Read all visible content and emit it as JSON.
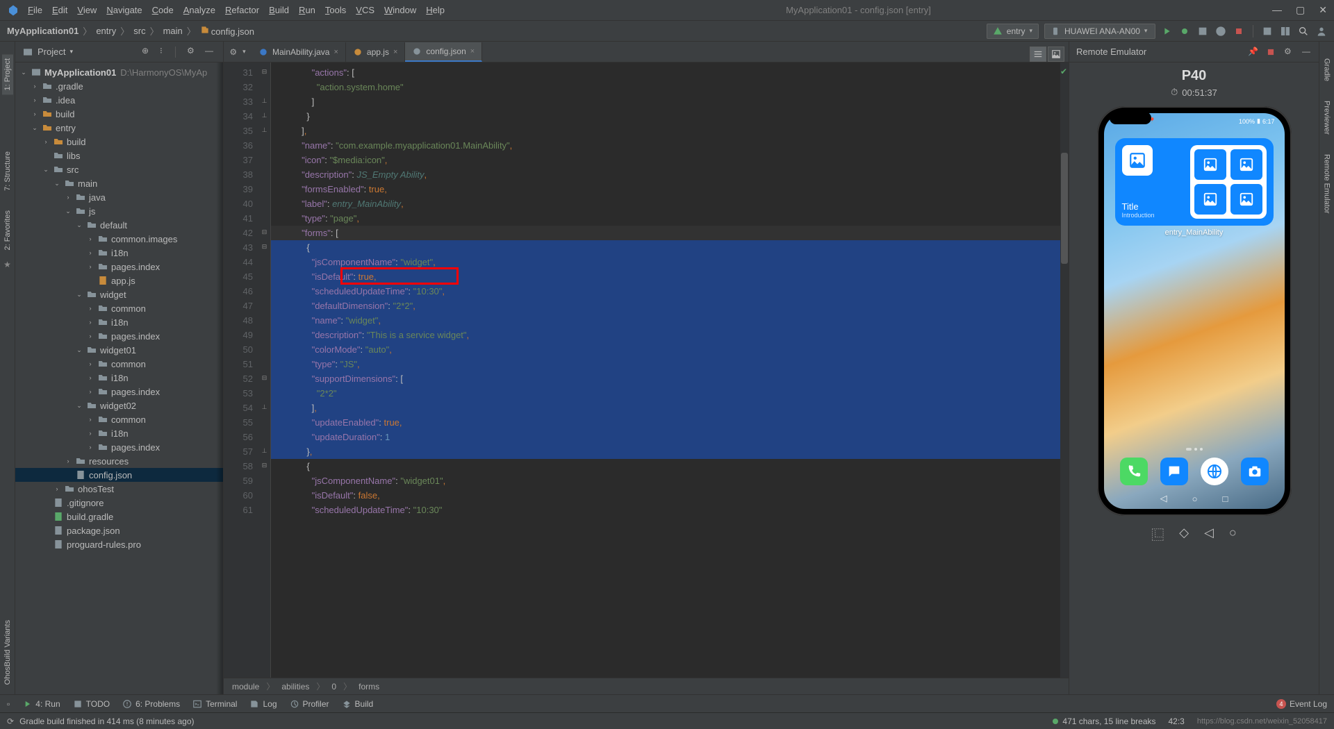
{
  "menubar": {
    "items": [
      "File",
      "Edit",
      "View",
      "Navigate",
      "Code",
      "Analyze",
      "Refactor",
      "Build",
      "Run",
      "Tools",
      "VCS",
      "Window",
      "Help"
    ],
    "title": "MyApplication01 - config.json [entry]"
  },
  "breadcrumbs": [
    "MyApplication01",
    "entry",
    "src",
    "main",
    "config.json"
  ],
  "run_config": {
    "module": "entry",
    "device": "HUAWEI ANA-AN00",
    "device_chev": "▾"
  },
  "editor_tabs": [
    {
      "name": "MainAbility.java",
      "icon": "java"
    },
    {
      "name": "app.js",
      "icon": "js"
    },
    {
      "name": "config.json",
      "icon": "json",
      "active": true
    }
  ],
  "project_panel": {
    "title": "Project"
  },
  "project_tree": {
    "root": {
      "name": "MyApplication01",
      "path": "D:\\HarmonyOS\\MyAp"
    },
    "rows": [
      {
        "indent": 1,
        "arrow": "›",
        "icon": "folder",
        "label": ".gradle"
      },
      {
        "indent": 1,
        "arrow": "›",
        "icon": "folder",
        "label": ".idea"
      },
      {
        "indent": 1,
        "arrow": "›",
        "icon": "folder-o",
        "label": "build"
      },
      {
        "indent": 1,
        "arrow": "⌄",
        "icon": "folder-o",
        "label": "entry"
      },
      {
        "indent": 2,
        "arrow": "›",
        "icon": "folder-o",
        "label": "build"
      },
      {
        "indent": 2,
        "arrow": "",
        "icon": "folder",
        "label": "libs"
      },
      {
        "indent": 2,
        "arrow": "⌄",
        "icon": "folder",
        "label": "src"
      },
      {
        "indent": 3,
        "arrow": "⌄",
        "icon": "folder",
        "label": "main"
      },
      {
        "indent": 4,
        "arrow": "›",
        "icon": "folder",
        "label": "java"
      },
      {
        "indent": 4,
        "arrow": "⌄",
        "icon": "folder",
        "label": "js"
      },
      {
        "indent": 5,
        "arrow": "⌄",
        "icon": "folder",
        "label": "default"
      },
      {
        "indent": 6,
        "arrow": "›",
        "icon": "folder",
        "label": "common.images"
      },
      {
        "indent": 6,
        "arrow": "›",
        "icon": "folder",
        "label": "i18n"
      },
      {
        "indent": 6,
        "arrow": "›",
        "icon": "folder",
        "label": "pages.index"
      },
      {
        "indent": 6,
        "arrow": "",
        "icon": "file-js",
        "label": "app.js"
      },
      {
        "indent": 5,
        "arrow": "⌄",
        "icon": "folder",
        "label": "widget"
      },
      {
        "indent": 6,
        "arrow": "›",
        "icon": "folder",
        "label": "common"
      },
      {
        "indent": 6,
        "arrow": "›",
        "icon": "folder",
        "label": "i18n"
      },
      {
        "indent": 6,
        "arrow": "›",
        "icon": "folder",
        "label": "pages.index"
      },
      {
        "indent": 5,
        "arrow": "⌄",
        "icon": "folder",
        "label": "widget01"
      },
      {
        "indent": 6,
        "arrow": "›",
        "icon": "folder",
        "label": "common"
      },
      {
        "indent": 6,
        "arrow": "›",
        "icon": "folder",
        "label": "i18n"
      },
      {
        "indent": 6,
        "arrow": "›",
        "icon": "folder",
        "label": "pages.index"
      },
      {
        "indent": 5,
        "arrow": "⌄",
        "icon": "folder",
        "label": "widget02"
      },
      {
        "indent": 6,
        "arrow": "›",
        "icon": "folder",
        "label": "common"
      },
      {
        "indent": 6,
        "arrow": "›",
        "icon": "folder",
        "label": "i18n"
      },
      {
        "indent": 6,
        "arrow": "›",
        "icon": "folder",
        "label": "pages.index"
      },
      {
        "indent": 4,
        "arrow": "›",
        "icon": "folder",
        "label": "resources"
      },
      {
        "indent": 4,
        "arrow": "",
        "icon": "file-json",
        "label": "config.json",
        "selected": true
      },
      {
        "indent": 3,
        "arrow": "›",
        "icon": "folder",
        "label": "ohosTest"
      },
      {
        "indent": 2,
        "arrow": "",
        "icon": "file",
        "label": ".gitignore"
      },
      {
        "indent": 2,
        "arrow": "",
        "icon": "file-gradle",
        "label": "build.gradle"
      },
      {
        "indent": 2,
        "arrow": "",
        "icon": "file-json",
        "label": "package.json"
      },
      {
        "indent": 2,
        "arrow": "",
        "icon": "file",
        "label": "proguard-rules.pro"
      }
    ]
  },
  "code": {
    "first_line": 31,
    "lines": [
      {
        "n": 31,
        "html": "              <span class='tok-key'>\"actions\"</span>: <span class='tok-brace'>[</span>"
      },
      {
        "n": 32,
        "html": "                <span class='tok-str'>\"action.system.home\"</span>"
      },
      {
        "n": 33,
        "html": "              <span class='tok-brace'>]</span>"
      },
      {
        "n": 34,
        "html": "            <span class='tok-brace'>}</span>"
      },
      {
        "n": 35,
        "html": "          <span class='tok-brace'>]</span><span class='tok-punc'>,</span>"
      },
      {
        "n": 36,
        "html": "          <span class='tok-key'>\"name\"</span>: <span class='tok-str'>\"com.example.myapplication01.MainAbility\"</span><span class='tok-punc'>,</span>"
      },
      {
        "n": 37,
        "html": "          <span class='tok-key'>\"icon\"</span>: <span class='tok-str'>\"$media:icon\"</span><span class='tok-punc'>,</span>"
      },
      {
        "n": 38,
        "html": "          <span class='tok-key'>\"description\"</span>: <span class='tok-ref'>JS_Empty Ability</span><span class='tok-punc'>,</span>"
      },
      {
        "n": 39,
        "html": "          <span class='tok-key'>\"formsEnabled\"</span>: <span class='tok-bool'>true</span><span class='tok-punc'>,</span>"
      },
      {
        "n": 40,
        "html": "          <span class='tok-key'>\"label\"</span>: <span class='tok-ref'>entry_MainAbility</span><span class='tok-punc'>,</span>"
      },
      {
        "n": 41,
        "html": "          <span class='tok-key'>\"type\"</span>: <span class='tok-str'>\"page\"</span><span class='tok-punc'>,</span>"
      },
      {
        "n": 42,
        "sel": true,
        "cursor": true,
        "html": "          <span class='tok-key'>\"forms\"</span>: <span class='tok-brace'>[</span>"
      },
      {
        "n": 43,
        "sel": true,
        "html": "            <span class='tok-brace'>{</span>"
      },
      {
        "n": 44,
        "sel": true,
        "html": "              <span class='tok-key'>\"jsComponentName\"</span>: <span class='tok-str'>\"widget\"</span><span class='tok-punc'>,</span>"
      },
      {
        "n": 45,
        "sel": true,
        "html": "              <span class='tok-key'>\"isDefault\"</span>: <span class='tok-bool'>true</span><span class='tok-punc'>,</span>"
      },
      {
        "n": 46,
        "sel": true,
        "html": "              <span class='tok-key'>\"scheduledUpdateTime\"</span>: <span class='tok-str'>\"10:30\"</span><span class='tok-punc'>,</span>"
      },
      {
        "n": 47,
        "sel": true,
        "html": "              <span class='tok-key'>\"defaultDimension\"</span>: <span class='tok-str'>\"2*2\"</span><span class='tok-punc'>,</span>"
      },
      {
        "n": 48,
        "sel": true,
        "html": "              <span class='tok-key'>\"name\"</span>: <span class='tok-str'>\"widget\"</span><span class='tok-punc'>,</span>"
      },
      {
        "n": 49,
        "sel": true,
        "html": "              <span class='tok-key'>\"description\"</span>: <span class='tok-str'>\"This is a service widget\"</span><span class='tok-punc'>,</span>"
      },
      {
        "n": 50,
        "sel": true,
        "html": "              <span class='tok-key'>\"colorMode\"</span>: <span class='tok-str'>\"auto\"</span><span class='tok-punc'>,</span>"
      },
      {
        "n": 51,
        "sel": true,
        "html": "              <span class='tok-key'>\"type\"</span>: <span class='tok-str'>\"JS\"</span><span class='tok-punc'>,</span>"
      },
      {
        "n": 52,
        "sel": true,
        "html": "              <span class='tok-key'>\"supportDimensions\"</span>: <span class='tok-brace'>[</span>"
      },
      {
        "n": 53,
        "sel": true,
        "html": "                <span class='tok-str'>\"2*2\"</span>"
      },
      {
        "n": 54,
        "sel": true,
        "html": "              <span class='tok-brace'>]</span><span class='tok-punc'>,</span>"
      },
      {
        "n": 55,
        "sel": true,
        "html": "              <span class='tok-key'>\"updateEnabled\"</span>: <span class='tok-bool'>true</span><span class='tok-punc'>,</span>"
      },
      {
        "n": 56,
        "sel": true,
        "html": "              <span class='tok-key'>\"updateDuration\"</span>: <span class='tok-num'>1</span>"
      },
      {
        "n": 57,
        "sel": true,
        "html": "            <span class='tok-brace'>}</span><span class='tok-punc'>,</span>"
      },
      {
        "n": 58,
        "html": "            <span class='tok-brace'>{</span>"
      },
      {
        "n": 59,
        "html": "              <span class='tok-key'>\"jsComponentName\"</span>: <span class='tok-str'>\"widget01\"</span><span class='tok-punc'>,</span>"
      },
      {
        "n": 60,
        "html": "              <span class='tok-key'>\"isDefault\"</span>: <span class='tok-bool'>false</span><span class='tok-punc'>,</span>"
      },
      {
        "n": 61,
        "html": "              <span class='tok-key'>\"scheduledUpdateTime\"</span>: <span class='tok-str'>\"10:30\"</span>"
      }
    ],
    "breadcrumb": [
      "module",
      "abilities",
      "0",
      "forms"
    ],
    "red_box_line": 45
  },
  "emulator": {
    "header": "Remote Emulator",
    "device": "P40",
    "timer": "00:51:37",
    "status_time": "6:17",
    "status_batt": "100%",
    "widget_title": "Title",
    "widget_sub": "Introduction",
    "widget_label": "entry_MainAbility"
  },
  "left_rail": {
    "tabs": [
      "1: Project",
      "7: Structure",
      "2: Favorites",
      "OhosBuild Variants"
    ]
  },
  "right_rail": {
    "tabs": [
      "Gradle",
      "Previewer",
      "Remote Emulator"
    ]
  },
  "bottom_bar": {
    "items": [
      "4: Run",
      "TODO",
      "6: Problems",
      "Terminal",
      "Log",
      "Profiler",
      "Build"
    ],
    "event_log": "Event Log",
    "event_badge": "4"
  },
  "status": {
    "message": "Gradle build finished in 414 ms (8 minutes ago)",
    "selection": "471 chars, 15 line breaks",
    "cursor": "42:3",
    "watermark": "https://blog.csdn.net/weixin_52058417"
  }
}
